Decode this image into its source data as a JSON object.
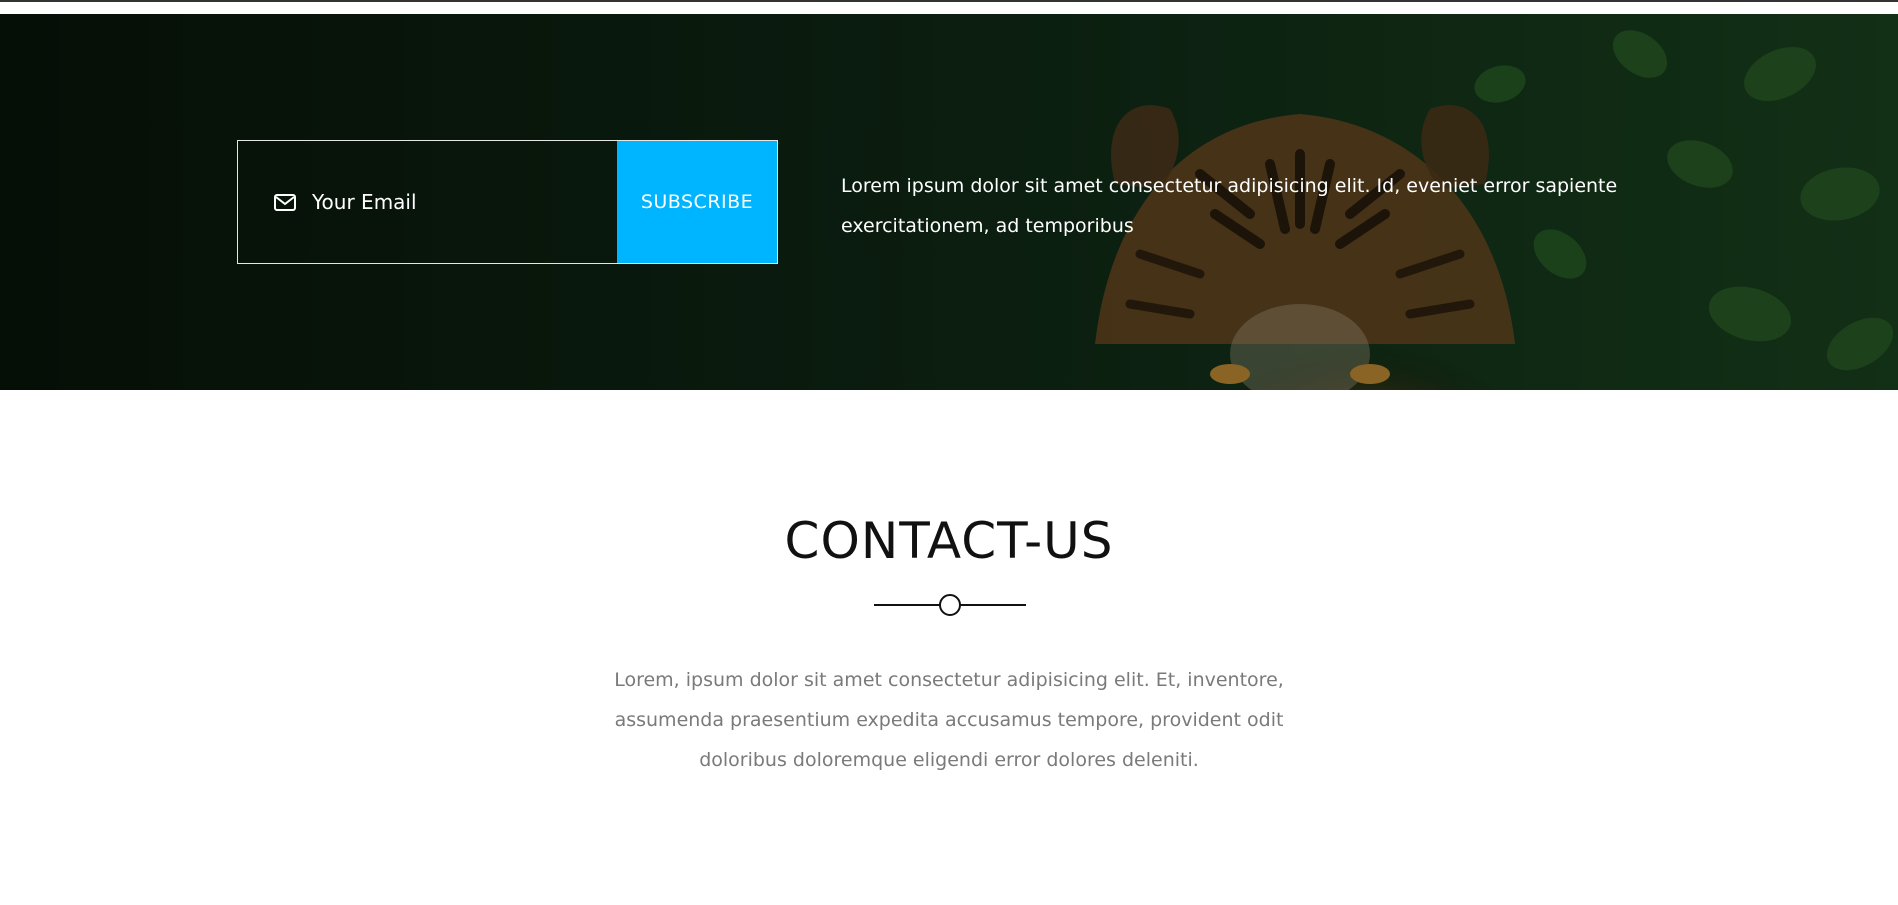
{
  "newsletter": {
    "email_placeholder": "Your Email",
    "subscribe_label": "SUBSCRIBE",
    "description": "Lorem ipsum dolor sit amet consectetur adipisicing elit. Id, eveniet error sapiente exercitationem, ad temporibus",
    "icons": {
      "email": "envelope-icon"
    },
    "colors": {
      "subscribe_button": "#00b5ff",
      "input_border": "#e6e6e6",
      "text": "#ffffff"
    }
  },
  "contact": {
    "title": "CONTACT-US",
    "description": "Lorem, ipsum dolor sit amet consectetur adipisicing elit. Et, inventore, assumenda praesentium expedita accusamus tempore, provident odit doloribus doloremque eligendi error dolores deleniti.",
    "colors": {
      "title": "#111111",
      "description": "#7a7a7a"
    }
  }
}
